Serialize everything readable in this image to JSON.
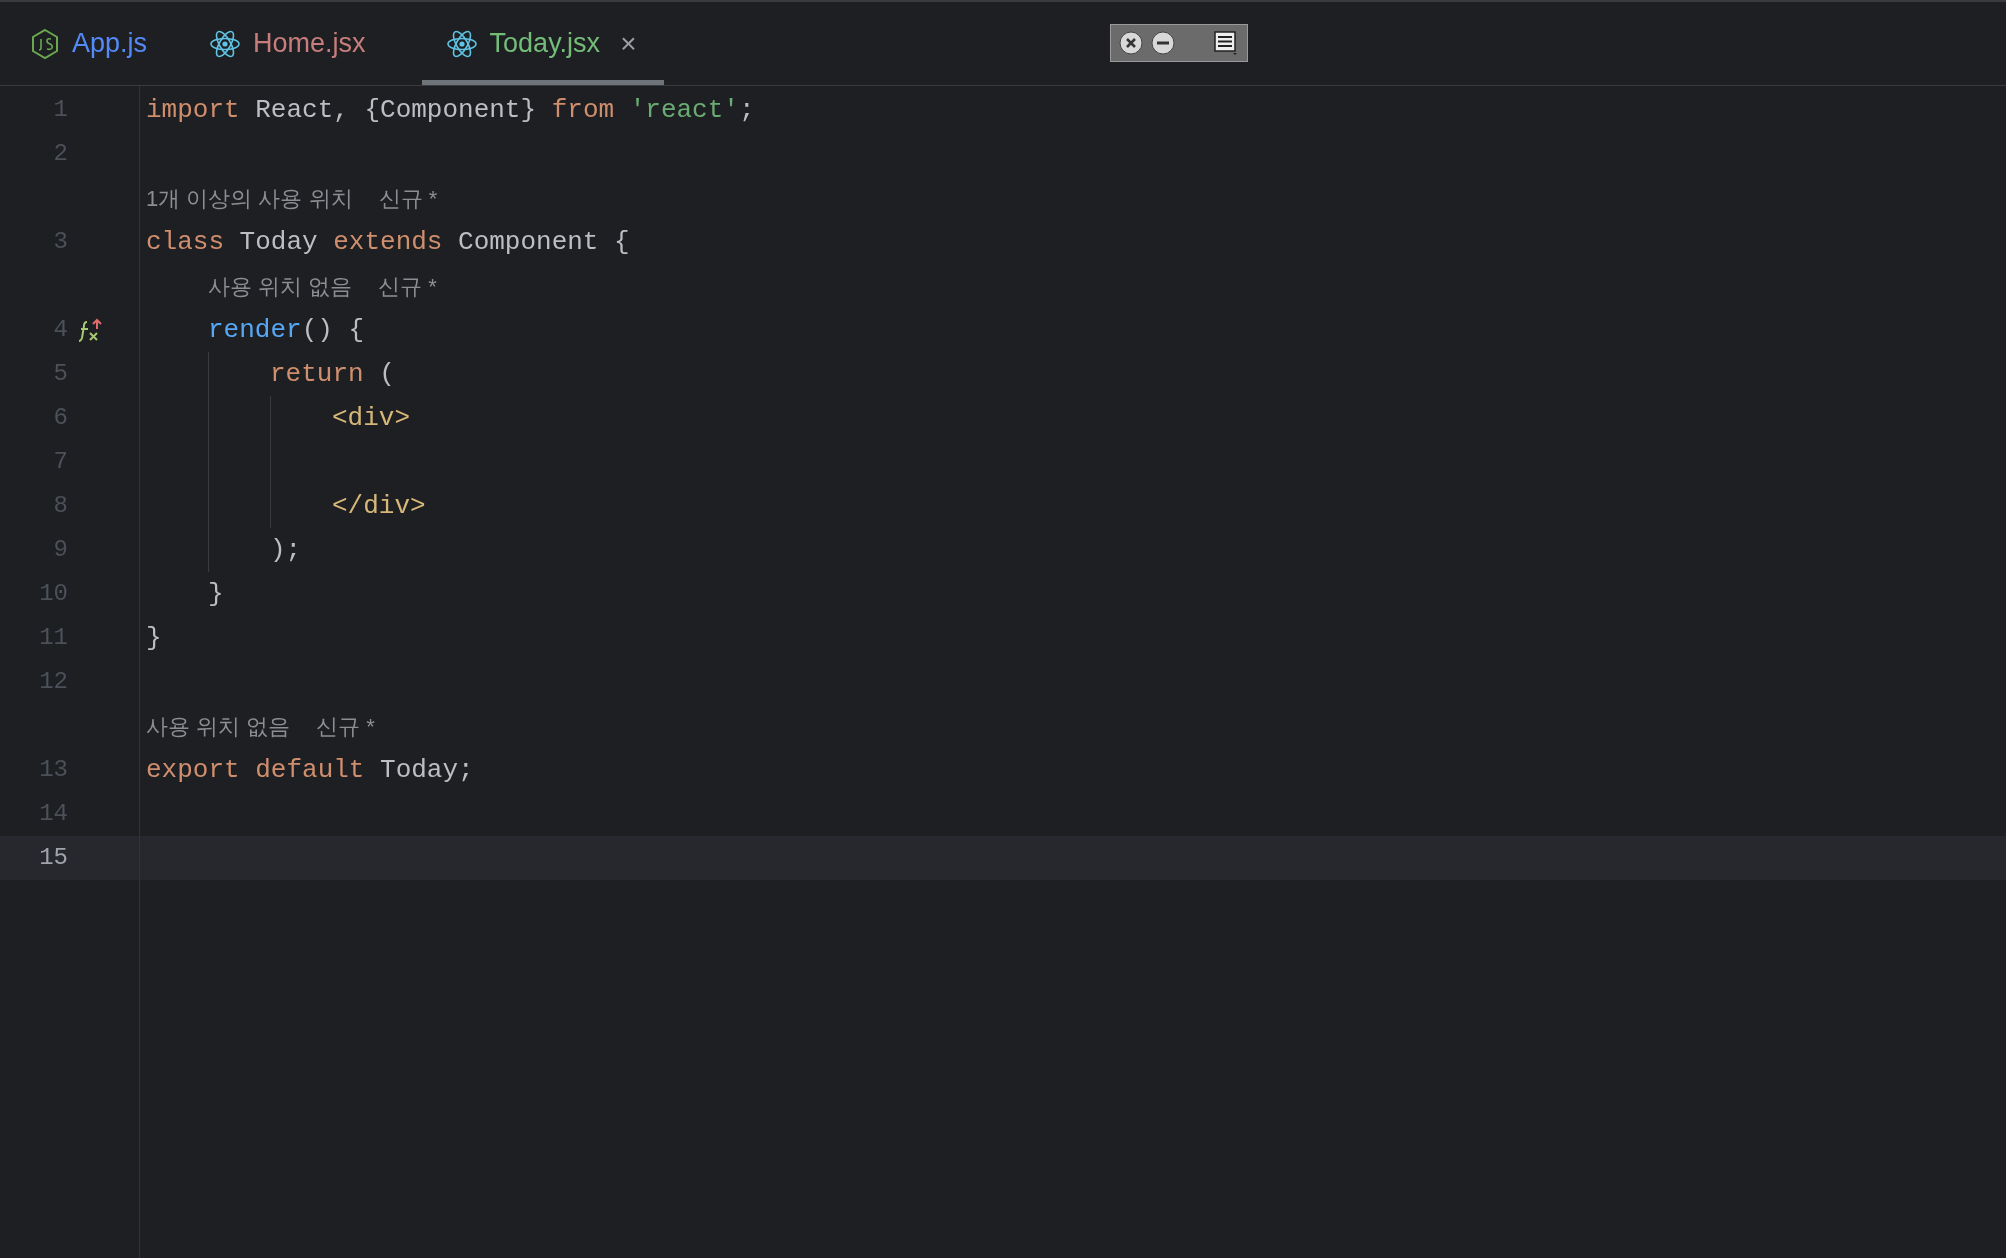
{
  "tabs": [
    {
      "label": "App.js",
      "kind": "node",
      "color": "#548af7",
      "selected": false,
      "closable": false
    },
    {
      "label": "Home.jsx",
      "kind": "react",
      "color": "#c77d7b",
      "selected": false,
      "closable": false
    },
    {
      "label": "Today.jsx",
      "kind": "react",
      "color": "#73bd79",
      "selected": true,
      "closable": true,
      "close_glyph": "×"
    }
  ],
  "lines": [
    {
      "kind": "code",
      "number": "1",
      "current": false,
      "tokens": [
        {
          "kind": "keyword",
          "text": "import"
        },
        {
          "kind": "plain",
          "text": "React, {Component}"
        },
        {
          "kind": "keyword",
          "text": "from"
        },
        {
          "kind": "string",
          "text": "'react'"
        },
        {
          "kind": "punct",
          "text": ";"
        }
      ]
    },
    {
      "kind": "code",
      "number": "2",
      "current": false
    },
    {
      "kind": "hint",
      "usages": "1개 이상의 사용 위치",
      "author": "신규 *"
    },
    {
      "kind": "code",
      "number": "3",
      "current": false,
      "tokens": [
        {
          "kind": "keyword",
          "text": "class"
        },
        {
          "kind": "plain",
          "text": "Today"
        },
        {
          "kind": "keyword",
          "text": "extends"
        },
        {
          "kind": "plain",
          "text": "Component {"
        }
      ],
      "children": [
        {
          "kind": "hint",
          "usages": "사용 위치 없음",
          "author": "신규 *"
        },
        {
          "kind": "code",
          "number": "4",
          "current": false,
          "gutter": {
            "kind": "override"
          },
          "tokens": [
            {
              "kind": "function",
              "text": "render"
            },
            {
              "kind": "punct",
              "text": "() {"
            }
          ],
          "children": [
            {
              "kind": "code",
              "number": "5",
              "current": false,
              "tokens": [
                {
                  "kind": "keyword",
                  "text": "return"
                },
                {
                  "kind": "plain",
                  "text": "("
                }
              ],
              "children": [
                {
                  "kind": "code",
                  "number": "6",
                  "current": false,
                  "tokens": [
                    {
                      "kind": "tag",
                      "text": "<div>"
                    }
                  ]
                },
                {
                  "kind": "code",
                  "number": "7",
                  "current": false
                },
                {
                  "kind": "code",
                  "number": "8",
                  "current": false,
                  "tokens": [
                    {
                      "kind": "tag",
                      "text": "</div>"
                    }
                  ]
                }
              ]
            },
            {
              "kind": "code",
              "number": "9",
              "current": false,
              "tokens": [
                {
                  "kind": "plain",
                  "text": ");"
                }
              ]
            }
          ]
        },
        {
          "kind": "code",
          "number": "10",
          "current": false,
          "tokens": [
            {
              "kind": "plain",
              "text": "}"
            }
          ]
        }
      ]
    },
    {
      "kind": "code",
      "number": "11",
      "current": false,
      "tokens": [
        {
          "kind": "plain",
          "text": "}"
        }
      ]
    },
    {
      "kind": "code",
      "number": "12",
      "current": false
    },
    {
      "kind": "hint",
      "usages": "사용 위치 없음",
      "author": "신규 *"
    },
    {
      "kind": "code",
      "number": "13",
      "current": false,
      "tokens": [
        {
          "kind": "keyword",
          "text": "export"
        },
        {
          "kind": "keyword",
          "text": "default"
        },
        {
          "kind": "plain",
          "text": "Today;"
        }
      ]
    },
    {
      "kind": "code",
      "number": "14",
      "current": false
    },
    {
      "kind": "code",
      "number": "15",
      "current": true
    }
  ]
}
